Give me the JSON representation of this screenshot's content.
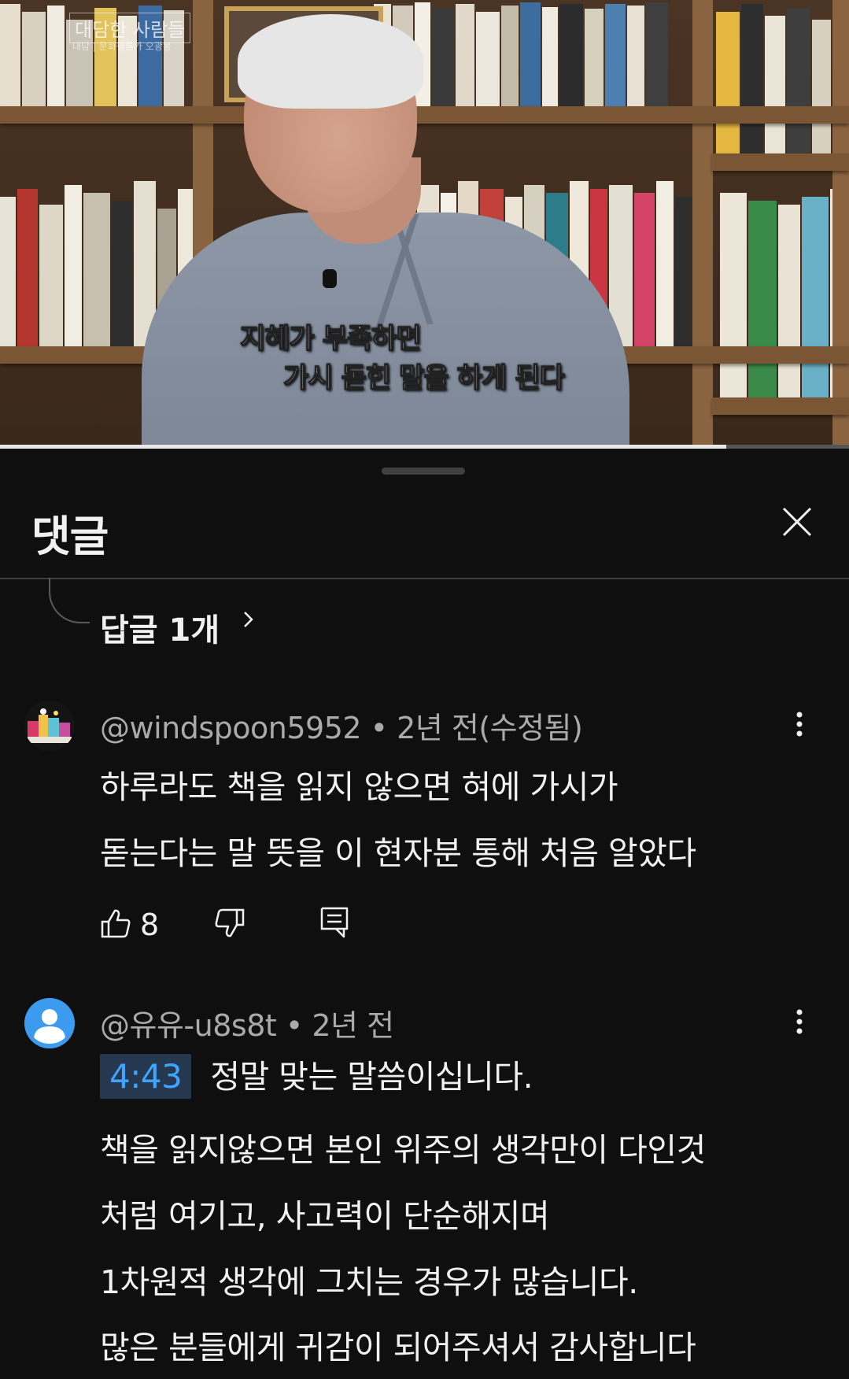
{
  "video": {
    "channel_tag": "대담한 사람들",
    "channel_sub": "대담 | 문화평론가 오광봉",
    "subtitle_line1": "지혜가 부족하면",
    "subtitle_line2": "가시 돋힌 말을 하게 된다",
    "progress": 0.855
  },
  "comments_panel": {
    "title": "댓글",
    "replies_link": "답글 1개",
    "comments": [
      {
        "author": "@windspoon5952",
        "separator": " • ",
        "time": "2년 전(수정됨)",
        "lines": [
          "하루라도 책을 읽지 않으면 혀에 가시가",
          "돋는다는 말 뜻을 이 현자분 통해 처음 알았다"
        ],
        "likes": "8"
      },
      {
        "author": "@유유-u8s8t",
        "separator": " • ",
        "time": "2년 전",
        "timestamp": "4:43",
        "lines": [
          "정말 맞는 말씀이십니다.",
          "책을 읽지않으면 본인 위주의 생각만이 다인것",
          "처럼 여기고, 사고력이 단순해지며",
          "1차원적 생각에 그치는 경우가 많습니다.",
          "많은 분들에게 귀감이 되어주셔서 감사합니다"
        ]
      }
    ]
  },
  "colors": {
    "background": "#0f0f0f",
    "text_primary": "#f1f1f1",
    "text_secondary": "#aaaaaa",
    "timestamp_link": "#3ea6ff",
    "timestamp_bg": "#263850",
    "default_avatar": "#3d9bef"
  },
  "icons": {
    "close": "close-icon",
    "chevron": "chevron-right-icon",
    "kebab": "more-vert-icon",
    "like": "thumb-up-icon",
    "dislike": "thumb-down-icon",
    "reply": "reply-icon",
    "avatar_default": "person-icon"
  }
}
